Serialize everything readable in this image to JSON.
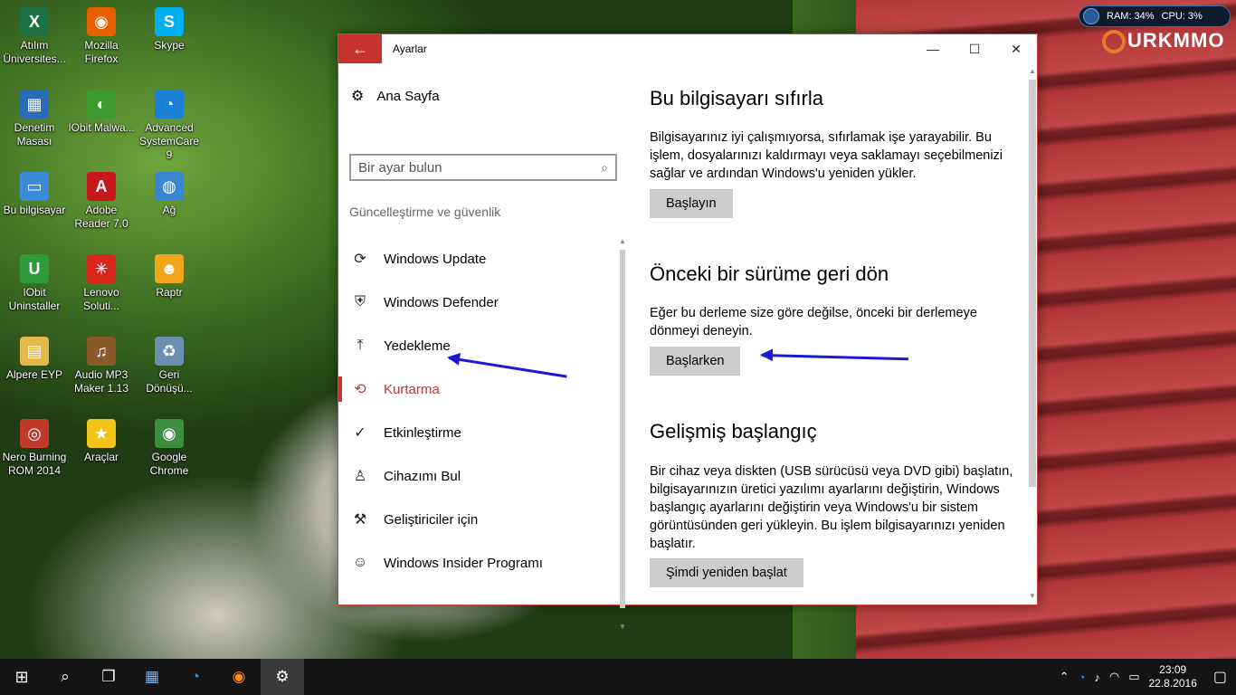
{
  "desktop": {
    "icons": [
      {
        "label": "Atılım Üniversites...",
        "glyph": "X",
        "color": "#1e7145",
        "icon": "excel-icon"
      },
      {
        "label": "Mozilla Firefox",
        "glyph": "◉",
        "color": "#e66000",
        "icon": "firefox-icon"
      },
      {
        "label": "Skype",
        "glyph": "S",
        "color": "#00aff0",
        "icon": "skype-icon"
      },
      {
        "label": "Denetim Masası",
        "glyph": "▦",
        "color": "#2b6cb8",
        "icon": "control-panel-icon"
      },
      {
        "label": "IObit Malwa...",
        "glyph": "◐",
        "color": "#3a9a2e",
        "icon": "iobit-malware-icon"
      },
      {
        "label": "Advanced SystemCare 9",
        "glyph": "◔",
        "color": "#1a7fd6",
        "icon": "advanced-systemcare-icon"
      },
      {
        "label": "Bu bilgisayar",
        "glyph": "▭",
        "color": "#3b8ad8",
        "icon": "computer-icon"
      },
      {
        "label": "Adobe Reader 7.0",
        "glyph": "A",
        "color": "#c8161d",
        "icon": "adobe-reader-icon"
      },
      {
        "label": "Ağ",
        "glyph": "◍",
        "color": "#3a86d0",
        "icon": "network-icon"
      },
      {
        "label": "IObit Uninstaller",
        "glyph": "U",
        "color": "#2f9a3a",
        "icon": "iobit-uninstaller-icon"
      },
      {
        "label": "Lenovo Soluti...",
        "glyph": "✳",
        "color": "#d8261d",
        "icon": "lenovo-icon"
      },
      {
        "label": "Raptr",
        "glyph": "☻",
        "color": "#f2a71b",
        "icon": "raptr-icon"
      },
      {
        "label": "Alpere EYP",
        "glyph": "▤",
        "color": "#e6b84a",
        "icon": "folder-icon"
      },
      {
        "label": "Audio MP3 Maker 1.13",
        "glyph": "♫",
        "color": "#8b5a2b",
        "icon": "audio-mp3-icon"
      },
      {
        "label": "Geri Dönüşü...",
        "glyph": "♻",
        "color": "#6b8fb0",
        "icon": "recycle-bin-icon"
      },
      {
        "label": "Nero Burning ROM 2014",
        "glyph": "◎",
        "color": "#c0392b",
        "icon": "nero-icon"
      },
      {
        "label": "Araçlar",
        "glyph": "★",
        "color": "#f2c318",
        "icon": "star-icon"
      },
      {
        "label": "Google Chrome",
        "glyph": "◉",
        "color": "#3e8e41",
        "icon": "chrome-icon"
      }
    ]
  },
  "widget": {
    "ram": "RAM: 34%",
    "cpu": "CPU: 3%"
  },
  "brand": "URKMMO",
  "window": {
    "title": "Ayarlar",
    "back_glyph": "←",
    "minimize": "—",
    "maximize": "☐",
    "close": "✕"
  },
  "left": {
    "home": "Ana Sayfa",
    "search_placeholder": "Bir ayar bulun",
    "section": "Güncelleştirme ve güvenlik",
    "nav": [
      {
        "label": "Windows Update",
        "glyph": "⟳",
        "icon": "refresh-icon"
      },
      {
        "label": "Windows Defender",
        "glyph": "⛨",
        "icon": "shield-icon"
      },
      {
        "label": "Yedekleme",
        "glyph": "⤒",
        "icon": "backup-arrow-icon"
      },
      {
        "label": "Kurtarma",
        "glyph": "⟲",
        "icon": "history-icon"
      },
      {
        "label": "Etkinleştirme",
        "glyph": "✓",
        "icon": "check-circle-icon"
      },
      {
        "label": "Cihazımı Bul",
        "glyph": "♙",
        "icon": "find-device-icon"
      },
      {
        "label": "Geliştiriciler için",
        "glyph": "⚒",
        "icon": "developer-tools-icon"
      },
      {
        "label": "Windows Insider Programı",
        "glyph": "☺",
        "icon": "insider-icon"
      }
    ],
    "active_index": 3
  },
  "right": {
    "reset": {
      "heading": "Bu bilgisayarı sıfırla",
      "body": "Bilgisayarınız iyi çalışmıyorsa, sıfırlamak işe yarayabilir. Bu işlem, dosyalarınızı kaldırmayı veya saklamayı seçebilmenizi sağlar ve ardından Windows'u yeniden yükler.",
      "button": "Başlayın"
    },
    "rollback": {
      "heading": "Önceki bir sürüme geri dön",
      "body": "Eğer bu derleme size göre değilse, önceki bir derlemeye dönmeyi deneyin.",
      "button": "Başlarken"
    },
    "advanced": {
      "heading": "Gelişmiş başlangıç",
      "body": "Bir cihaz veya diskten (USB sürücüsü veya DVD gibi) başlatın, bilgisayarınızın üretici yazılımı ayarlarını değiştirin, Windows başlangıç ayarlarını değiştirin veya Windows'u bir sistem görüntüsünden geri yükleyin. Bu işlem bilgisayarınızı yeniden başlatır.",
      "button": "Şimdi yeniden başlat"
    }
  },
  "taskbar": {
    "time": "23:09",
    "date": "22.8.2016"
  }
}
